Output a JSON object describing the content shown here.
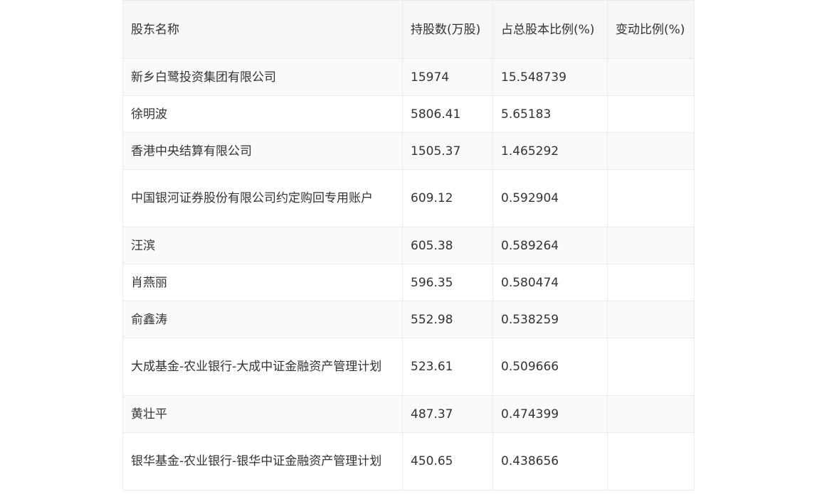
{
  "table": {
    "headers": [
      "股东名称",
      "持股数(万股)",
      "占总股本比例(%)",
      "变动比例(%)"
    ],
    "rows": [
      {
        "name": "新乡白鹭投资集团有限公司",
        "shares": "15974",
        "ratio": "15.548739",
        "change": ""
      },
      {
        "name": "徐明波",
        "shares": "5806.41",
        "ratio": "5.65183",
        "change": ""
      },
      {
        "name": "香港中央结算有限公司",
        "shares": "1505.37",
        "ratio": "1.465292",
        "change": ""
      },
      {
        "name": "中国银河证券股份有限公司约定购回专用账户",
        "shares": "609.12",
        "ratio": "0.592904",
        "change": ""
      },
      {
        "name": "汪滨",
        "shares": "605.38",
        "ratio": "0.589264",
        "change": ""
      },
      {
        "name": "肖燕丽",
        "shares": "596.35",
        "ratio": "0.580474",
        "change": ""
      },
      {
        "name": "俞鑫涛",
        "shares": "552.98",
        "ratio": "0.538259",
        "change": ""
      },
      {
        "name": "大成基金-农业银行-大成中证金融资产管理计划",
        "shares": "523.61",
        "ratio": "0.509666",
        "change": ""
      },
      {
        "name": "黄壮平",
        "shares": "487.37",
        "ratio": "0.474399",
        "change": ""
      },
      {
        "name": "银华基金-农业银行-银华中证金融资产管理计划",
        "shares": "450.65",
        "ratio": "0.438656",
        "change": ""
      }
    ]
  }
}
